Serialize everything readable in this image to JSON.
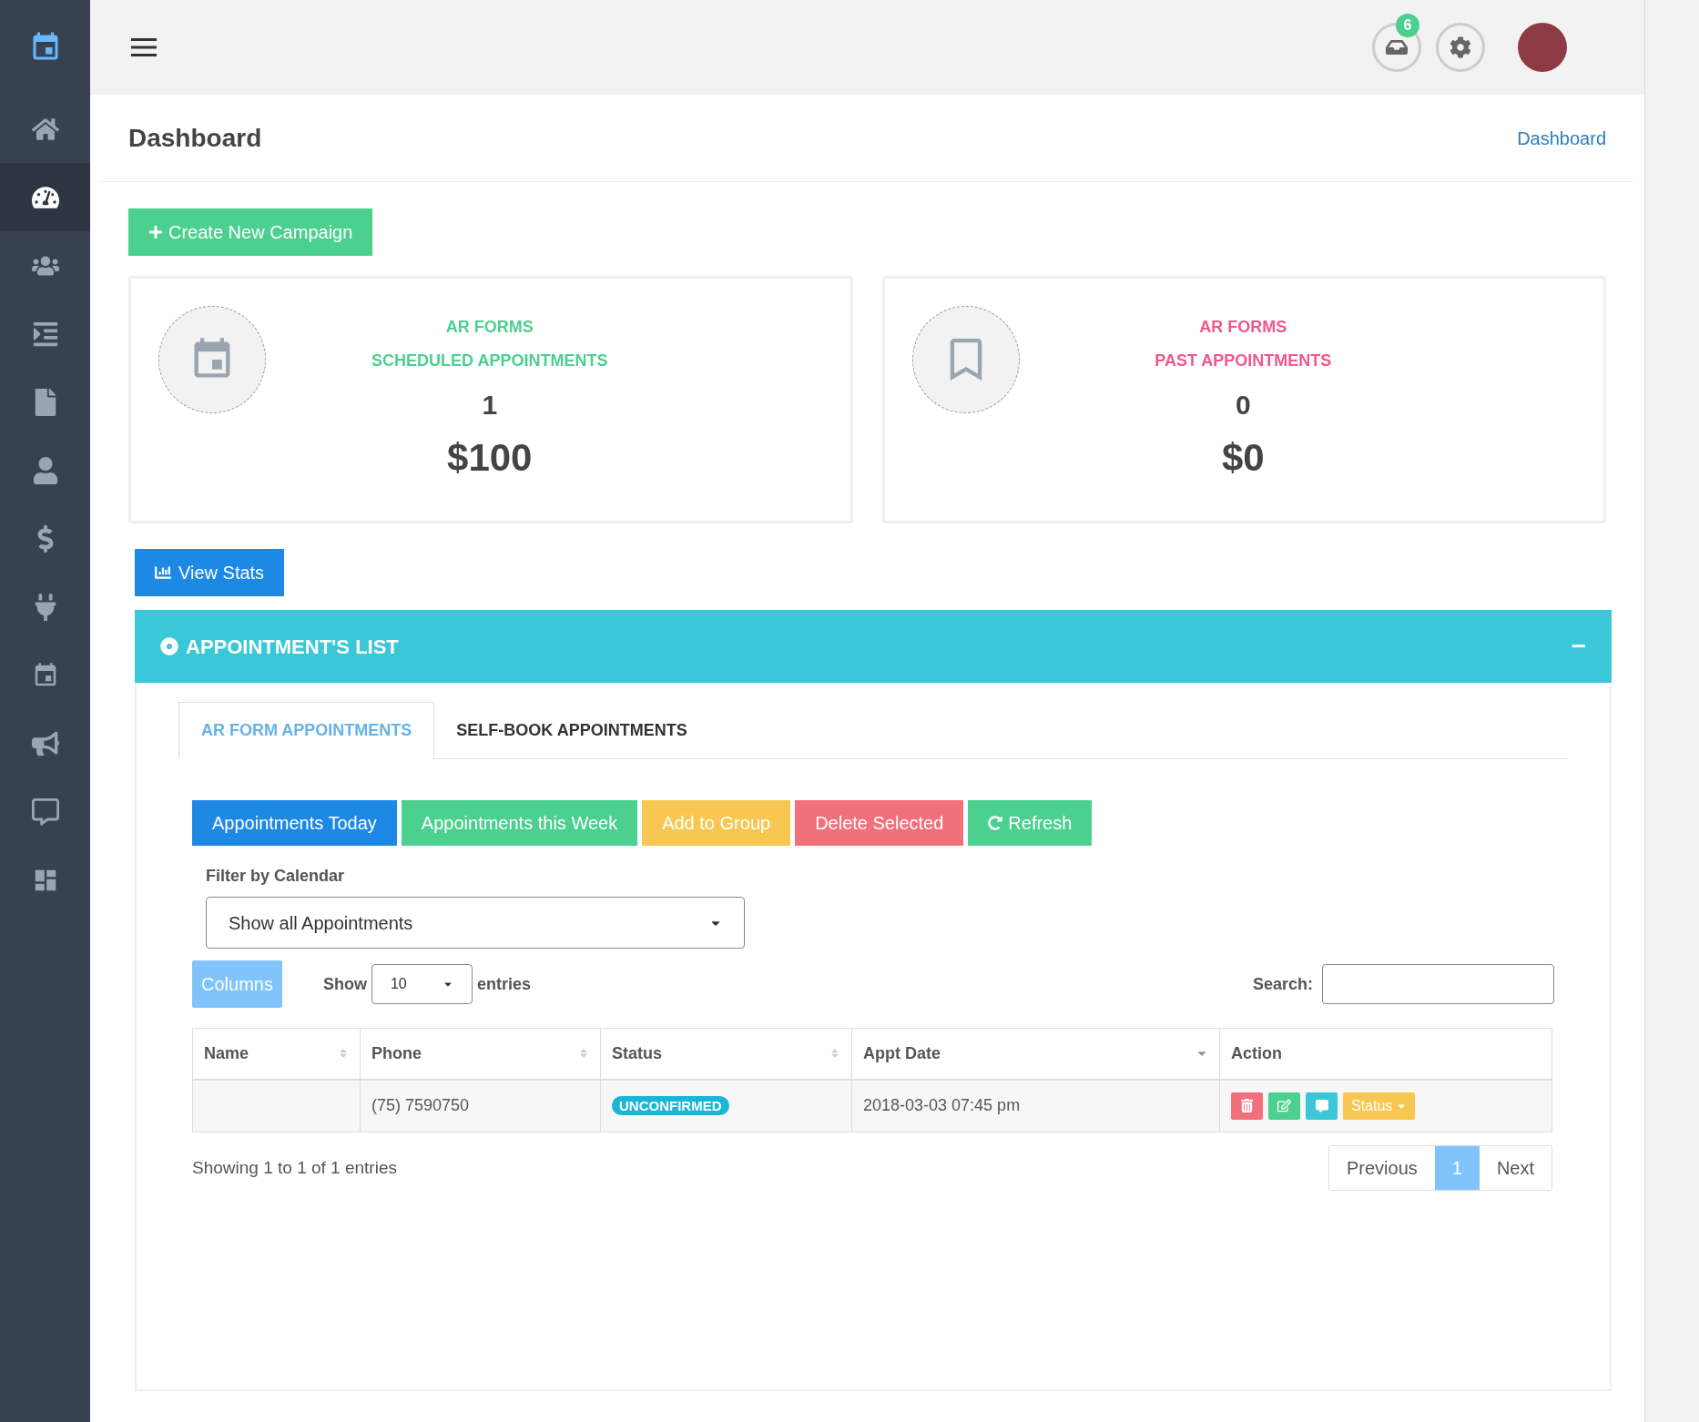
{
  "sidebar": {
    "items": [
      {
        "selected": false
      },
      {
        "selected": true
      },
      {
        "selected": false
      },
      {
        "selected": false
      },
      {
        "selected": false
      },
      {
        "selected": false
      },
      {
        "selected": false
      },
      {
        "selected": false
      },
      {
        "selected": false
      },
      {
        "selected": false
      },
      {
        "selected": false
      },
      {
        "selected": false
      }
    ]
  },
  "header": {
    "inbox_badge": "6"
  },
  "page": {
    "title": "Dashboard",
    "breadcrumb": "Dashboard"
  },
  "create_button": "Create New Campaign",
  "cards": [
    {
      "title_1": "AR FORMS",
      "title_2": "SCHEDULED APPOINTMENTS",
      "count": "1",
      "amount": "$100",
      "color": "#4cd08f"
    },
    {
      "title_1": "AR FORMS",
      "title_2": "PAST APPOINTMENTS",
      "count": "0",
      "amount": "$0",
      "color": "#f0588c"
    }
  ],
  "view_stats": "View Stats",
  "panel": {
    "title": "APPOINTMENT'S LIST",
    "collapse": "−"
  },
  "tabs": [
    {
      "label": "AR FORM APPOINTMENTS",
      "selected": true
    },
    {
      "label": "SELF-BOOK APPOINTMENTS",
      "selected": false
    }
  ],
  "actions": [
    {
      "label": "Appointments Today",
      "color": "#1e88e5"
    },
    {
      "label": "Appointments this Week",
      "color": "#4cd08f"
    },
    {
      "label": "Add to Group",
      "color": "#f7c752"
    },
    {
      "label": "Delete Selected",
      "color": "#f1707a"
    },
    {
      "label": "Refresh",
      "color": "#4cd08f"
    }
  ],
  "filter": {
    "label": "Filter by Calendar",
    "value": "Show all Appointments"
  },
  "columns_button": "Columns",
  "length": {
    "show": "Show",
    "value": "10",
    "entries": "entries"
  },
  "search": {
    "label": "Search:"
  },
  "table": {
    "columns": [
      "Name",
      "Phone",
      "Status",
      "Appt Date",
      "Action"
    ],
    "rows": [
      {
        "name": "",
        "phone": "(75) 7590750",
        "status": "UNCONFIRMED",
        "date": "2018-03-03 07:45 pm",
        "status_button": "Status"
      }
    ]
  },
  "info": "Showing 1 to 1 of 1 entries",
  "pagination": [
    {
      "label": "Previous",
      "selected": false
    },
    {
      "label": "1",
      "selected": true
    },
    {
      "label": "Next",
      "selected": false
    }
  ]
}
